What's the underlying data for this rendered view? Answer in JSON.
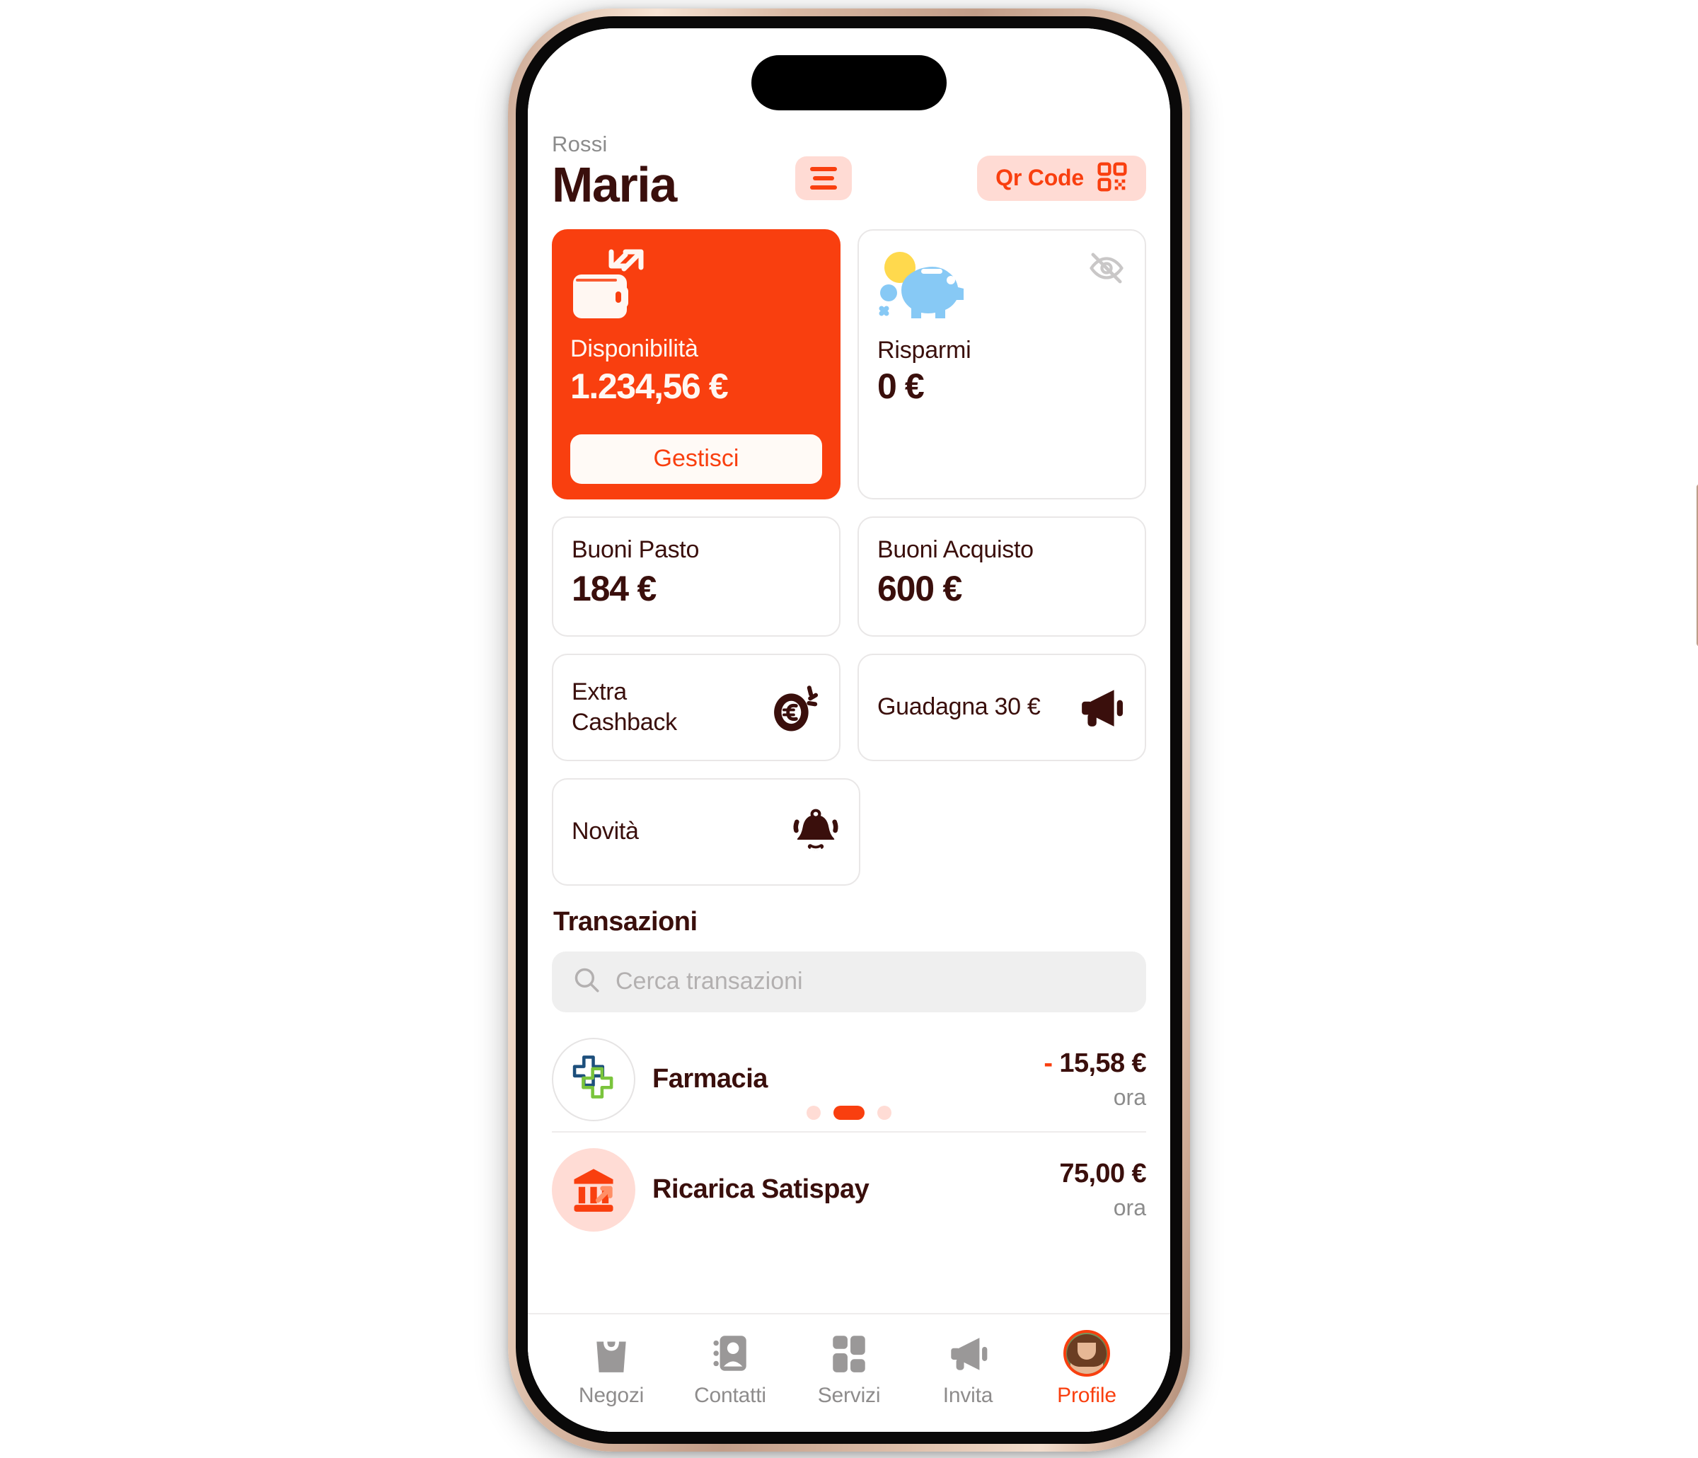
{
  "colors": {
    "brand_orange": "#f93f0f",
    "brand_tint": "#ffdbd4",
    "text_dark": "#3a0f0c",
    "text_muted": "#8c8c8c",
    "card_border": "#e9e7e7",
    "search_bg": "#efefef"
  },
  "header": {
    "surname": "Rossi",
    "firstname": "Maria",
    "menu_icon": "hamburger-menu-icon",
    "qr_button_label": "Qr Code",
    "qr_icon": "qr-code-icon"
  },
  "balance_card": {
    "icon": "wallet-exchange-icon",
    "label": "Disponibilità",
    "amount": "1.234,56 €",
    "manage_label": "Gestisci"
  },
  "savings_card": {
    "icon": "piggy-bank-icon",
    "hide_icon": "eye-slash-icon",
    "label": "Risparmi",
    "amount": "0 €"
  },
  "vouchers": [
    {
      "label": "Buoni Pasto",
      "amount": "184 €"
    },
    {
      "label": "Buoni Acquisto",
      "amount": "600 €"
    }
  ],
  "actions": [
    {
      "label": "Extra\nCashback",
      "icon": "euro-coin-sparkle-icon"
    },
    {
      "label": "Guadagna 30 €",
      "icon": "megaphone-icon"
    },
    {
      "label": "Novità",
      "icon": "bell-ring-icon"
    }
  ],
  "transactions": {
    "title": "Transazioni",
    "search_placeholder": "Cerca transazioni",
    "search_value": "",
    "search_icon": "search-icon",
    "rows": [
      {
        "icon": "pharmacy-cross-icon",
        "name": "Farmacia",
        "amount_sign": "-",
        "amount": "15,58 €",
        "time": "ora"
      },
      {
        "icon": "bank-topup-icon",
        "name": "Ricarica Satispay",
        "amount_sign": "",
        "amount": "75,00 €",
        "time": "ora"
      }
    ],
    "page_dots": {
      "count": 3,
      "active_index": 1
    }
  },
  "bottom_nav": [
    {
      "label": "Negozi",
      "icon": "shopping-bag-icon",
      "active": false
    },
    {
      "label": "Contatti",
      "icon": "contact-book-icon",
      "active": false
    },
    {
      "label": "Servizi",
      "icon": "grid-services-icon",
      "active": false
    },
    {
      "label": "Invita",
      "icon": "megaphone-icon",
      "active": false
    },
    {
      "label": "Profile",
      "icon": "user-avatar-icon",
      "active": true
    }
  ]
}
